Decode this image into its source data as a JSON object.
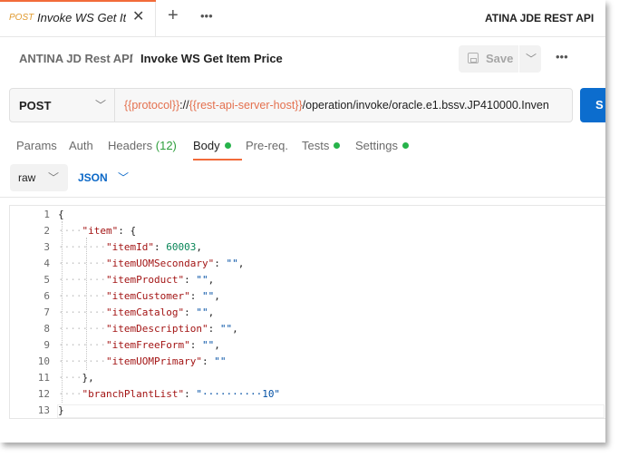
{
  "tabs": {
    "active": {
      "method": "POST",
      "title": "Invoke WS Get It..."
    },
    "environment": "ATINA JDE REST API"
  },
  "header": {
    "collection": "ANTINA JD Rest API",
    "separator": "/",
    "request_name": "Invoke WS Get Item Price",
    "save_label": "Save"
  },
  "request": {
    "method": "POST",
    "url_parts": {
      "v1": "{{protocol}}",
      "t1": "://",
      "v2": "{{rest-api-server-host}}",
      "t2": "/operation/invoke/oracle.e1.bssv.JP410000.Inven"
    },
    "send_label": "S"
  },
  "subtabs": {
    "params": "Params",
    "auth": "Auth",
    "headers": "Headers",
    "headers_count": "(12)",
    "body": "Body",
    "prereq": "Pre-req.",
    "tests": "Tests",
    "settings": "Settings"
  },
  "body_options": {
    "mode": "raw",
    "language": "JSON"
  },
  "editor": {
    "line_numbers": [
      "1",
      "2",
      "3",
      "4",
      "5",
      "6",
      "7",
      "8",
      "9",
      "10",
      "11",
      "12",
      "13"
    ]
  },
  "colors": {
    "accent": "#f26b3a",
    "variable": "#e4714f",
    "send": "#0c6dce",
    "status_dot": "#26b34a",
    "json_key": "#a31515",
    "json_number": "#098658",
    "json_string": "#0451a5"
  }
}
